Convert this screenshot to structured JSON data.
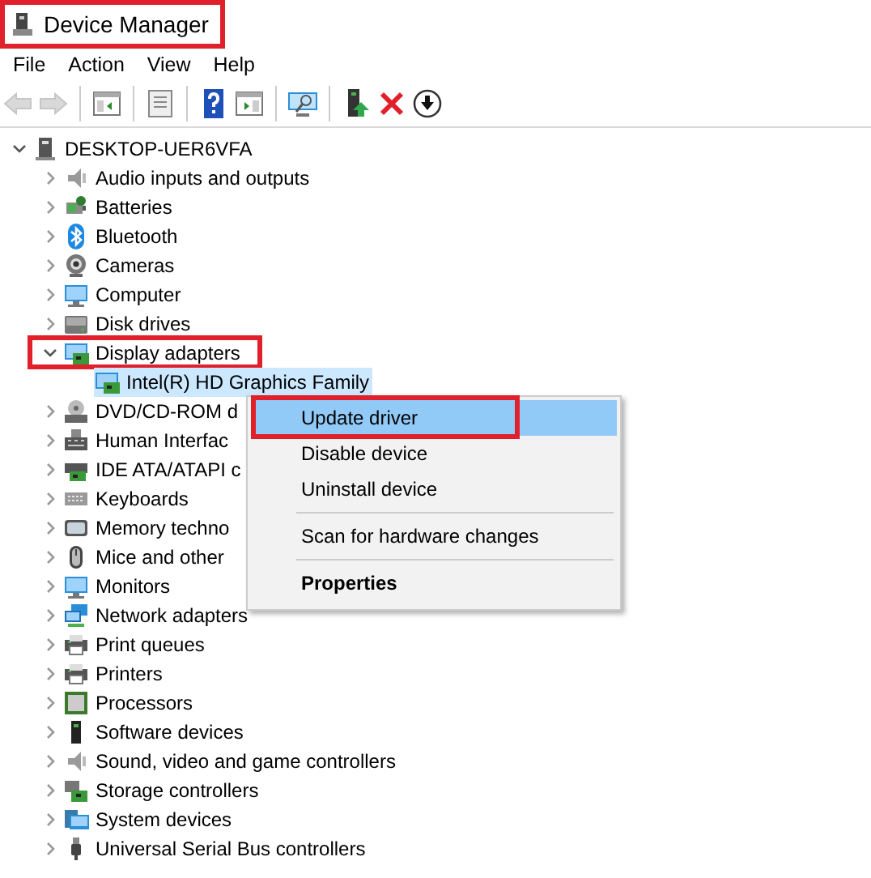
{
  "window": {
    "title": "Device Manager",
    "outlined": true
  },
  "menu_bar": [
    "File",
    "Action",
    "View",
    "Help"
  ],
  "toolbar": [
    {
      "kind": "back",
      "disabled": true
    },
    {
      "kind": "forward",
      "disabled": true
    },
    {
      "kind": "separator"
    },
    {
      "kind": "console_tree",
      "disabled": false
    },
    {
      "kind": "separator"
    },
    {
      "kind": "properties",
      "disabled": false
    },
    {
      "kind": "separator"
    },
    {
      "kind": "help",
      "disabled": false
    },
    {
      "kind": "action_pane",
      "disabled": false
    },
    {
      "kind": "separator"
    },
    {
      "kind": "scan",
      "disabled": false
    },
    {
      "kind": "separator"
    },
    {
      "kind": "update_driver",
      "disabled": false
    },
    {
      "kind": "uninstall",
      "disabled": false
    },
    {
      "kind": "disable",
      "disabled": false
    }
  ],
  "tree": {
    "items": [
      {
        "label": "DESKTOP-UER6VFA",
        "kind": "computer",
        "expanded": true,
        "selected": false,
        "outlined": false,
        "children": [
          {
            "label": "Audio inputs and outputs",
            "kind": "speaker",
            "expanded": false,
            "selected": false,
            "outlined": false
          },
          {
            "label": "Batteries",
            "kind": "battery",
            "expanded": false,
            "selected": false,
            "outlined": false
          },
          {
            "label": "Bluetooth",
            "kind": "bluetooth",
            "expanded": false,
            "selected": false,
            "outlined": false
          },
          {
            "label": "Cameras",
            "kind": "camera",
            "expanded": false,
            "selected": false,
            "outlined": false
          },
          {
            "label": "Computer",
            "kind": "monitor",
            "expanded": false,
            "selected": false,
            "outlined": false
          },
          {
            "label": "Disk drives",
            "kind": "disk",
            "expanded": false,
            "selected": false,
            "outlined": false
          },
          {
            "label": "Display adapters",
            "kind": "display",
            "expanded": true,
            "selected": false,
            "outlined": true,
            "children": [
              {
                "label": "Intel(R) HD Graphics Family",
                "kind": "display",
                "selected": true,
                "outlined": false
              }
            ]
          },
          {
            "label": "DVD/CD-ROM d",
            "kind": "dvd",
            "expanded": false,
            "selected": false,
            "outlined": false
          },
          {
            "label": "Human Interfac",
            "kind": "hid",
            "expanded": false,
            "selected": false,
            "outlined": false
          },
          {
            "label": "IDE ATA/ATAPI c",
            "kind": "ide",
            "expanded": false,
            "selected": false,
            "outlined": false
          },
          {
            "label": "Keyboards",
            "kind": "keyboard",
            "expanded": false,
            "selected": false,
            "outlined": false
          },
          {
            "label": "Memory techno",
            "kind": "memory",
            "expanded": false,
            "selected": false,
            "outlined": false
          },
          {
            "label": "Mice and other",
            "kind": "mouse",
            "expanded": false,
            "selected": false,
            "outlined": false
          },
          {
            "label": "Monitors",
            "kind": "monitor",
            "expanded": false,
            "selected": false,
            "outlined": false
          },
          {
            "label": "Network adapters",
            "kind": "network",
            "expanded": false,
            "selected": false,
            "outlined": false
          },
          {
            "label": "Print queues",
            "kind": "printer",
            "expanded": false,
            "selected": false,
            "outlined": false
          },
          {
            "label": "Printers",
            "kind": "printer",
            "expanded": false,
            "selected": false,
            "outlined": false
          },
          {
            "label": "Processors",
            "kind": "chip",
            "expanded": false,
            "selected": false,
            "outlined": false
          },
          {
            "label": "Software devices",
            "kind": "software",
            "expanded": false,
            "selected": false,
            "outlined": false
          },
          {
            "label": "Sound, video and game controllers",
            "kind": "speaker",
            "expanded": false,
            "selected": false,
            "outlined": false
          },
          {
            "label": "Storage controllers",
            "kind": "storage",
            "expanded": false,
            "selected": false,
            "outlined": false
          },
          {
            "label": "System devices",
            "kind": "system",
            "expanded": false,
            "selected": false,
            "outlined": false
          },
          {
            "label": "Universal Serial Bus controllers",
            "kind": "usb",
            "expanded": false,
            "selected": false,
            "outlined": false
          }
        ]
      }
    ]
  },
  "context_menu": {
    "items": [
      {
        "kind": "item",
        "label": "Update driver",
        "selected": true,
        "outlined": true,
        "default": false
      },
      {
        "kind": "item",
        "label": "Disable device",
        "selected": false,
        "outlined": false,
        "default": false
      },
      {
        "kind": "item",
        "label": "Uninstall device",
        "selected": false,
        "outlined": false,
        "default": false
      },
      {
        "kind": "separator"
      },
      {
        "kind": "item",
        "label": "Scan for hardware changes",
        "selected": false,
        "outlined": false,
        "default": false
      },
      {
        "kind": "separator"
      },
      {
        "kind": "item",
        "label": "Properties",
        "selected": false,
        "outlined": false,
        "default": true
      }
    ]
  }
}
